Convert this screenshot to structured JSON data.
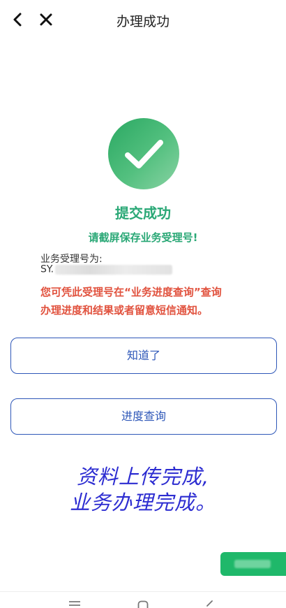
{
  "header": {
    "title": "办理成功"
  },
  "result": {
    "heading": "提交成功",
    "notice": "请截屏保存业务受理号!",
    "number_label": "业务受理号为:",
    "number_prefix": "SY.",
    "hint_line1": "您可凭此受理号在“业务进度查询”查询",
    "hint_line2": "办理进度和结果或者留意短信通知。"
  },
  "buttons": {
    "known_label": "知道了",
    "query_label": "进度查询"
  },
  "caption": {
    "line1": "资料上传完成,",
    "line2": "业务办理完成。"
  },
  "colors": {
    "success_green": "#2aa876",
    "warning_red": "#e1523e",
    "button_blue": "#2e57b8",
    "caption_blue": "#2d2dd1",
    "float_green": "#1fb86a"
  },
  "icons": {
    "back": "chevron-left-icon",
    "close": "close-icon",
    "success": "checkmark-icon",
    "nav_menu": "menu-icon",
    "nav_home": "home-icon",
    "nav_back": "back-icon"
  }
}
